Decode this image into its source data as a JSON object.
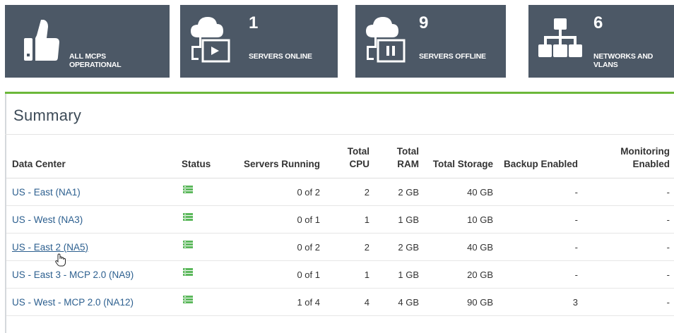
{
  "tiles": [
    {
      "count": "",
      "label": "ALL MCPS OPERATIONAL",
      "icon": "thumbs-up-icon"
    },
    {
      "count": "1",
      "label": "SERVERS ONLINE",
      "icon": "cloud-server-play-icon"
    },
    {
      "count": "9",
      "label": "SERVERS OFFLINE",
      "icon": "cloud-server-pause-icon"
    },
    {
      "count": "6",
      "label": "NETWORKS AND VLANS",
      "icon": "network-tree-icon"
    }
  ],
  "summary": {
    "title": "Summary",
    "columns": [
      "Data Center",
      "Status",
      "Servers Running",
      "Total CPU",
      "Total RAM",
      "Total Storage",
      "Backup Enabled",
      "Monitoring Enabled"
    ],
    "rows": [
      {
        "name": "US - East (NA1)",
        "status": "server-stack-icon",
        "running": "0 of 2",
        "cpu": "2",
        "ram": "2 GB",
        "storage": "40 GB",
        "backup": "-",
        "monitoring": "-"
      },
      {
        "name": "US - West (NA3)",
        "status": "server-stack-icon",
        "running": "0 of 1",
        "cpu": "1",
        "ram": "1 GB",
        "storage": "10 GB",
        "backup": "-",
        "monitoring": "-"
      },
      {
        "name": "US - East 2 (NA5)",
        "status": "server-stack-icon",
        "running": "0 of 2",
        "cpu": "2",
        "ram": "2 GB",
        "storage": "40 GB",
        "backup": "-",
        "monitoring": "-"
      },
      {
        "name": "US - East 3 - MCP 2.0 (NA9)",
        "status": "server-stack-icon",
        "running": "0 of 1",
        "cpu": "1",
        "ram": "1 GB",
        "storage": "20 GB",
        "backup": "-",
        "monitoring": "-"
      },
      {
        "name": "US - West - MCP 2.0 (NA12)",
        "status": "server-stack-icon",
        "running": "1 of 4",
        "cpu": "4",
        "ram": "4 GB",
        "storage": "90 GB",
        "backup": "3",
        "monitoring": "-"
      }
    ]
  },
  "colors": {
    "tile_bg": "#4c5866",
    "accent_green": "#6cb83a",
    "link": "#2c5f8f",
    "status_green": "#5cb85c"
  }
}
